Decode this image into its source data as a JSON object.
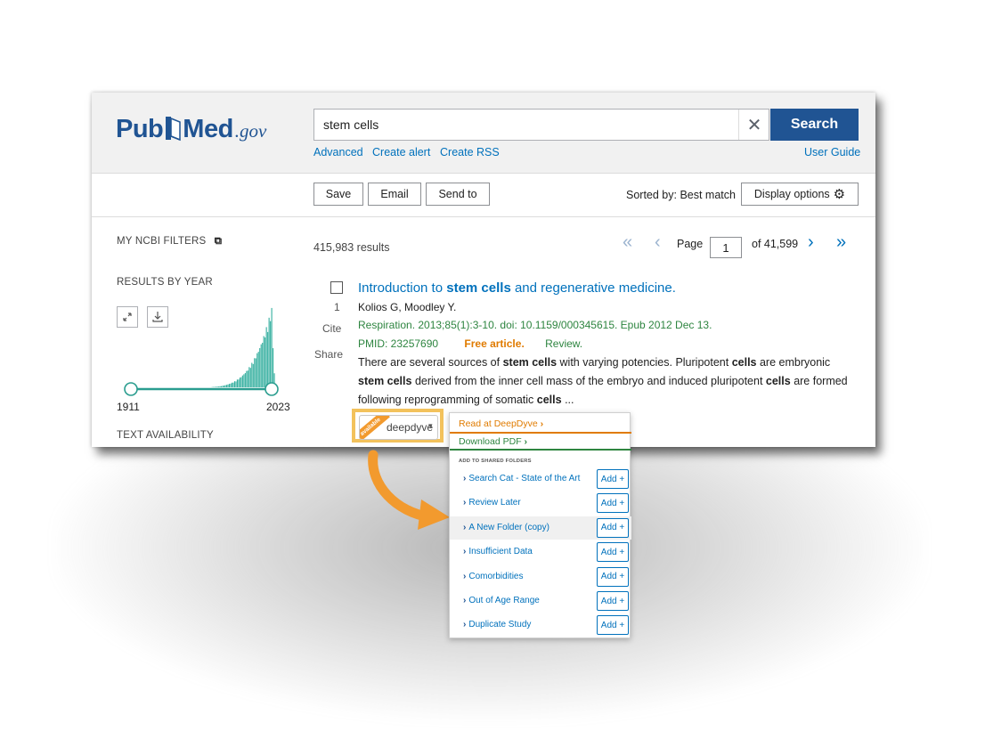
{
  "logo": {
    "pub": "Pub",
    "med": "Med",
    "gov": ".gov"
  },
  "search": {
    "value": "stem cells",
    "clear_icon": "close-icon",
    "button_label": "Search"
  },
  "links": {
    "advanced": "Advanced",
    "create_alert": "Create alert",
    "create_rss": "Create RSS",
    "user_guide": "User Guide"
  },
  "toolbar": {
    "save": "Save",
    "email": "Email",
    "send_to": "Send to",
    "sorted_by": "Sorted by: Best match",
    "display_options": "Display options"
  },
  "sidebar": {
    "ncbi_filters": "MY NCBI FILTERS",
    "results_by_year": "RESULTS BY YEAR",
    "year_start": "1911",
    "year_end": "2023",
    "text_availability": "TEXT AVAILABILITY",
    "range_start_fraction": 0.0,
    "range_end_fraction": 1.0
  },
  "results": {
    "count": "415,983 results",
    "page_label": "Page",
    "page_value": "1",
    "of_pages": "of 41,599"
  },
  "article": {
    "index": "1",
    "cite": "Cite",
    "share": "Share",
    "title_pre": "Introduction to ",
    "title_bold": "stem cells",
    "title_post": " and regenerative medicine.",
    "authors": "Kolios G, Moodley Y.",
    "citation": "Respiration. 2013;85(1):3-10. doi: 10.1159/000345615. Epub 2012 Dec 13.",
    "pmid": "PMID: 23257690",
    "free": "Free article.",
    "review": "Review.",
    "snippet": {
      "l1a": "There are several sources of ",
      "l1b": "stem cells",
      "l1c": " with varying potencies. Pluripotent ",
      "l1d": "cells",
      "l1e": " are embryonic",
      "l2a": "stem cells",
      "l2b": " derived from the inner cell mass of the embryo and induced pluripotent ",
      "l2c": "cells",
      "l2d": " are formed",
      "l3a": "following reprogramming of somatic ",
      "l3b": "cells",
      "l3c": " ..."
    }
  },
  "deepdyve": {
    "ribbon": "available",
    "brand": "deepdyve",
    "caret": "▾",
    "read": "Read at DeepDyve",
    "download": "Download PDF",
    "folders_title": "ADD TO SHARED FOLDERS",
    "add_label": "Add +",
    "folders": [
      "Search Cat - State of the Art",
      "Review Later",
      "A New Folder (copy)",
      "Insufficient Data",
      "Comorbidities",
      "Out of Age Range",
      "Duplicate Study"
    ],
    "highlighted_index": 2
  },
  "chart_data": {
    "type": "bar",
    "title": "",
    "x_range": [
      1911,
      2023
    ],
    "trend": "near zero until ~1980, rising steeply to peak near 2021",
    "color": "#37b0a0"
  },
  "colors": {
    "brand_blue": "#205493",
    "link_blue": "#0071bc",
    "green": "#2e8540",
    "orange": "#e07b00",
    "highlight": "#f3c25c"
  }
}
